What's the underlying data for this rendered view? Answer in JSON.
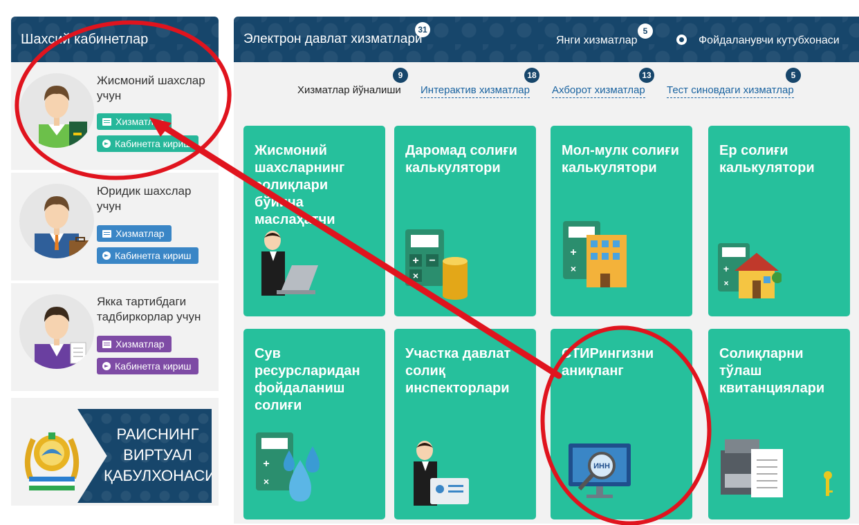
{
  "left_panel": {
    "title": "Шахсий кабинетлар",
    "cards": [
      {
        "title": "Жисмоний шахслар учун",
        "services_label": "Хизматлар",
        "login_label": "Кабинетга кириш",
        "accent": "#26b79a"
      },
      {
        "title": "Юридик шахслар учун",
        "services_label": "Хизматлар",
        "login_label": "Кабинетга кириш",
        "accent": "#3a86c6"
      },
      {
        "title": "Якка тартибдаги тадбиркорлар учун",
        "services_label": "Хизматлар",
        "login_label": "Кабинетга кириш",
        "accent": "#7e4ba5"
      }
    ],
    "reception": {
      "line1": "РАИСНИНГ",
      "line2": "ВИРТУАЛ",
      "line3": "ҚАБУЛХОНАСИ"
    }
  },
  "top_bar": {
    "eservices_label": "Электрон давлат хизматлари",
    "eservices_count": "31",
    "new_services_label": "Янги хизматлар",
    "new_services_count": "5",
    "library_label": "Фойдаланувчи кутубхонаси",
    "library_icon": "lifebuoy-icon"
  },
  "sub_bar": {
    "directions_label": "Хизматлар йўналиши",
    "directions_count": "9",
    "interactive_label": "Интерактив хизматлар",
    "interactive_count": "18",
    "info_label": "Ахборот хизматлар",
    "info_count": "13",
    "test_label": "Тест синовдаги хизматлар",
    "test_count": "5"
  },
  "tiles": [
    {
      "title": "Жисмоний шахсларнинг солиқлари бўйича маслаҳатчи",
      "icon": "consultant-laptop-icon"
    },
    {
      "title": "Даромад солиғи калькулятори",
      "icon": "calculator-coins-icon"
    },
    {
      "title": "Мол-мулк солиғи калькулятори",
      "icon": "calculator-building-icon"
    },
    {
      "title": "Ер солиғи калькулятори",
      "icon": "calculator-house-icon"
    },
    {
      "title": "Сув ресурсларидан фойдаланиш солиғи",
      "icon": "calculator-water-icon"
    },
    {
      "title": "Участка давлат солиқ инспекторлари",
      "icon": "inspector-card-icon"
    },
    {
      "title": "СТИРингизни аниқланг",
      "icon": "inn-search-icon",
      "icon_text": "ИНН"
    },
    {
      "title": "Солиқларни тўлаш квитанциялари",
      "icon": "printer-receipt-icon"
    }
  ],
  "colors": {
    "navy": "#17466b",
    "teal": "#26c09c",
    "annotation_red": "#e0141e"
  }
}
